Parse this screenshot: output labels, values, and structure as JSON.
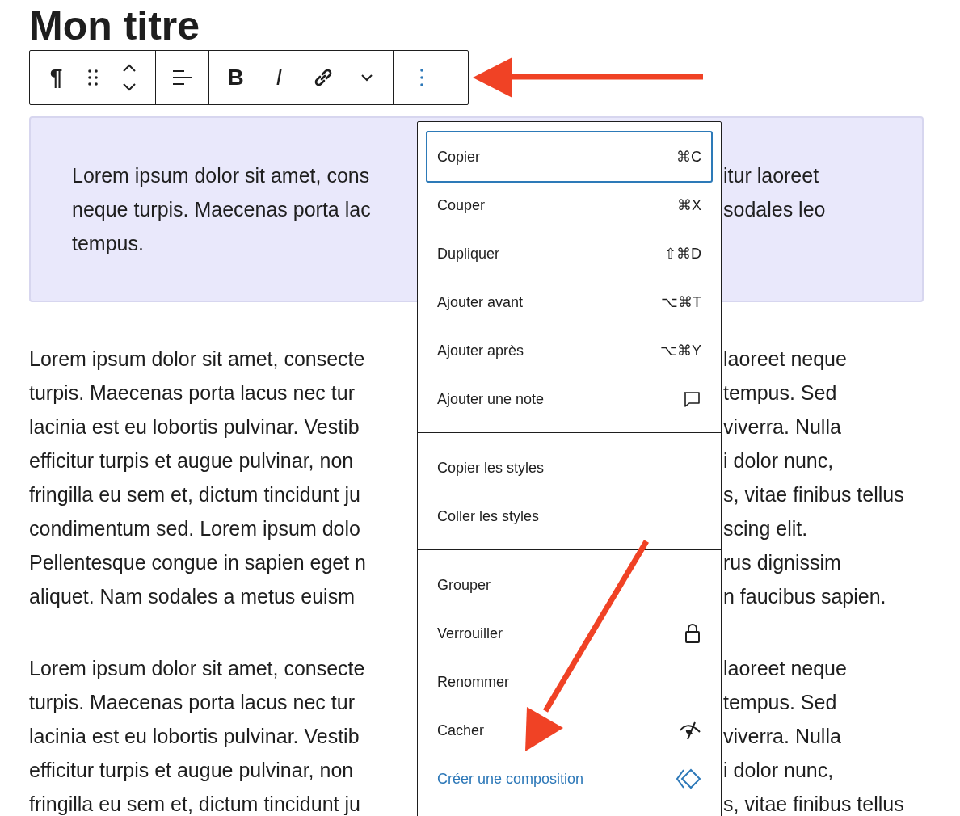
{
  "title": "Mon titre",
  "toolbar": {
    "block_type": "¶",
    "bold": "B",
    "italic": "I",
    "options_open": true
  },
  "highlighted_block": {
    "lines": [
      {
        "left": "Lorem ipsum dolor sit amet, cons",
        "right": "itur laoreet"
      },
      {
        "left": "neque turpis. Maecenas porta lac",
        "right": "sodales leo"
      },
      {
        "left": "tempus."
      }
    ]
  },
  "paragraphs": [
    {
      "lines": [
        {
          "left": "Lorem ipsum dolor sit amet, consecte",
          "right": "laoreet neque"
        },
        {
          "left": "turpis. Maecenas porta lacus nec tur",
          "right": "tempus. Sed"
        },
        {
          "left": "lacinia est eu lobortis pulvinar. Vestib",
          "right": "viverra. Nulla"
        },
        {
          "left": "efficitur turpis et augue pulvinar, non",
          "right": "i dolor nunc,"
        },
        {
          "left": "fringilla eu sem et, dictum tincidunt ju",
          "right": "s, vitae finibus tellus"
        },
        {
          "left": "condimentum sed. Lorem ipsum dolo",
          "right": "scing elit."
        },
        {
          "left": "Pellentesque congue in sapien eget n",
          "right": "rus dignissim"
        },
        {
          "left": "aliquet. Nam sodales a metus euism",
          "right": "n faucibus sapien."
        }
      ]
    },
    {
      "lines": [
        {
          "left": "Lorem ipsum dolor sit amet, consecte",
          "right": "laoreet neque"
        },
        {
          "left": "turpis. Maecenas porta lacus nec tur",
          "right": "tempus. Sed"
        },
        {
          "left": "lacinia est eu lobortis pulvinar. Vestib",
          "right": "viverra. Nulla"
        },
        {
          "left": "efficitur turpis et augue pulvinar, non",
          "right": "i dolor nunc,"
        },
        {
          "left": "fringilla eu sem et, dictum tincidunt ju",
          "right": "s, vitae finibus tellus"
        }
      ]
    }
  ],
  "menu": {
    "groups": [
      [
        {
          "label": "Copier",
          "kind": "shortcut",
          "shortcut": "⌘C",
          "selected": true,
          "accent": false
        },
        {
          "label": "Couper",
          "kind": "shortcut",
          "shortcut": "⌘X",
          "selected": false,
          "accent": false
        },
        {
          "label": "Dupliquer",
          "kind": "shortcut",
          "shortcut": "⇧⌘D",
          "selected": false,
          "accent": false
        },
        {
          "label": "Ajouter avant",
          "kind": "shortcut",
          "shortcut": "⌥⌘T",
          "selected": false,
          "accent": false
        },
        {
          "label": "Ajouter après",
          "kind": "shortcut",
          "shortcut": "⌥⌘Y",
          "selected": false,
          "accent": false
        },
        {
          "label": "Ajouter une note",
          "kind": "comment",
          "selected": false,
          "accent": false
        }
      ],
      [
        {
          "label": "Copier les styles",
          "kind": "plain",
          "selected": false,
          "accent": false
        },
        {
          "label": "Coller les styles",
          "kind": "plain",
          "selected": false,
          "accent": false
        }
      ],
      [
        {
          "label": "Grouper",
          "kind": "plain",
          "selected": false,
          "accent": false
        },
        {
          "label": "Verrouiller",
          "kind": "lock",
          "selected": false,
          "accent": false
        },
        {
          "label": "Renommer",
          "kind": "plain",
          "selected": false,
          "accent": false
        },
        {
          "label": "Cacher",
          "kind": "hide",
          "selected": false,
          "accent": false
        },
        {
          "label": "Créer une composition",
          "kind": "pattern",
          "selected": false,
          "accent": true
        }
      ]
    ]
  }
}
